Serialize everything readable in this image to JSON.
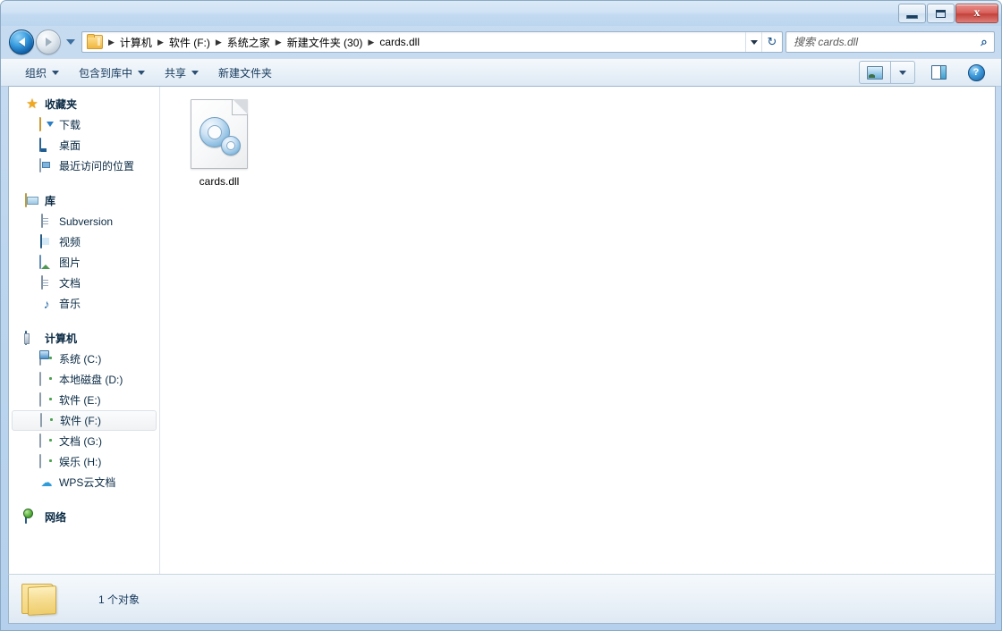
{
  "window": {
    "title": "",
    "controls": {
      "minimize": "minimize",
      "maximize": "maximize",
      "close": "x"
    }
  },
  "address": {
    "back_tooltip": "后退",
    "forward_tooltip": "前进",
    "breadcrumbs": [
      "计算机",
      "软件 (F:)",
      "系统之家",
      "新建文件夹 (30)",
      "cards.dll"
    ],
    "separator": "▶",
    "refresh_glyph": "↻"
  },
  "search": {
    "placeholder": "搜索 cards.dll",
    "value": "",
    "icon": "search-icon"
  },
  "toolbar": {
    "items": [
      {
        "label": "组织",
        "has_caret": true
      },
      {
        "label": "包含到库中",
        "has_caret": true
      },
      {
        "label": "共享",
        "has_caret": true
      },
      {
        "label": "新建文件夹",
        "has_caret": false
      }
    ],
    "right_buttons": [
      {
        "name": "change-view-button",
        "icon": "views-icon"
      },
      {
        "name": "change-view-dropdown",
        "icon": "chevron-down-icon"
      },
      {
        "name": "preview-pane-button",
        "icon": "preview-pane-icon"
      },
      {
        "name": "help-button",
        "icon": "help-icon",
        "glyph": "?"
      }
    ]
  },
  "sidebar": {
    "groups": [
      {
        "header": {
          "label": "收藏夹",
          "icon": "star-icon"
        },
        "items": [
          {
            "label": "下载",
            "icon": "download-folder-icon",
            "selected": false
          },
          {
            "label": "桌面",
            "icon": "desktop-icon",
            "selected": false
          },
          {
            "label": "最近访问的位置",
            "icon": "recent-places-icon",
            "selected": false
          }
        ]
      },
      {
        "header": {
          "label": "库",
          "icon": "library-icon"
        },
        "items": [
          {
            "label": "Subversion",
            "icon": "document-library-icon",
            "selected": false
          },
          {
            "label": "视频",
            "icon": "video-library-icon",
            "selected": false
          },
          {
            "label": "图片",
            "icon": "picture-library-icon",
            "selected": false
          },
          {
            "label": "文档",
            "icon": "document-library-icon",
            "selected": false
          },
          {
            "label": "音乐",
            "icon": "music-library-icon",
            "glyph": "♪",
            "selected": false
          }
        ]
      },
      {
        "header": {
          "label": "计算机",
          "icon": "computer-icon"
        },
        "items": [
          {
            "label": "系统 (C:)",
            "icon": "system-drive-icon",
            "selected": false
          },
          {
            "label": "本地磁盘 (D:)",
            "icon": "drive-icon",
            "selected": false
          },
          {
            "label": "软件 (E:)",
            "icon": "drive-icon",
            "selected": false
          },
          {
            "label": "软件 (F:)",
            "icon": "drive-icon",
            "selected": true
          },
          {
            "label": "文档 (G:)",
            "icon": "drive-icon",
            "selected": false
          },
          {
            "label": "娱乐 (H:)",
            "icon": "drive-icon",
            "selected": false
          },
          {
            "label": "WPS云文档",
            "icon": "cloud-icon",
            "glyph": "☁",
            "selected": false
          }
        ]
      },
      {
        "header": {
          "label": "网络",
          "icon": "network-icon"
        },
        "items": []
      }
    ]
  },
  "content": {
    "files": [
      {
        "name": "cards.dll",
        "icon": "dll-file-icon"
      }
    ]
  },
  "statusbar": {
    "icon": "folder-icon",
    "text": "1 个对象"
  }
}
